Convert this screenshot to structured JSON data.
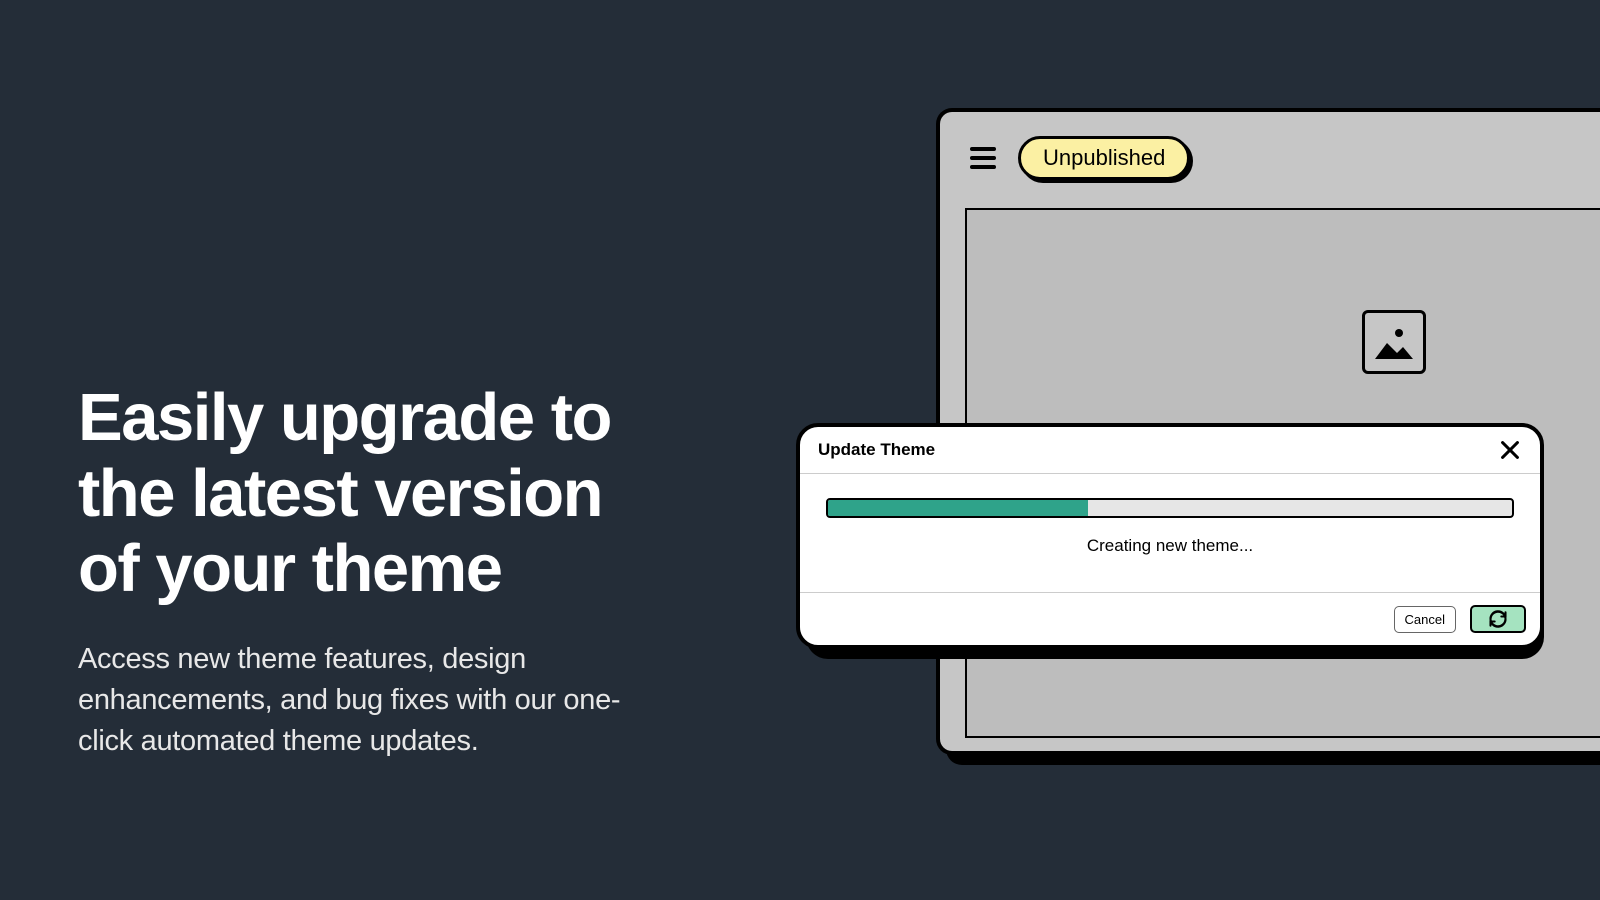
{
  "heading": "Easily upgrade to the latest version of your theme",
  "description": "Access new theme features, design enhancements, and bug fixes with our one-click automated theme updates.",
  "mockup": {
    "badge_label": "Unpublished"
  },
  "dialog": {
    "title": "Update Theme",
    "status_text": "Creating new theme...",
    "cancel_label": "Cancel",
    "progress_percent": 38
  }
}
